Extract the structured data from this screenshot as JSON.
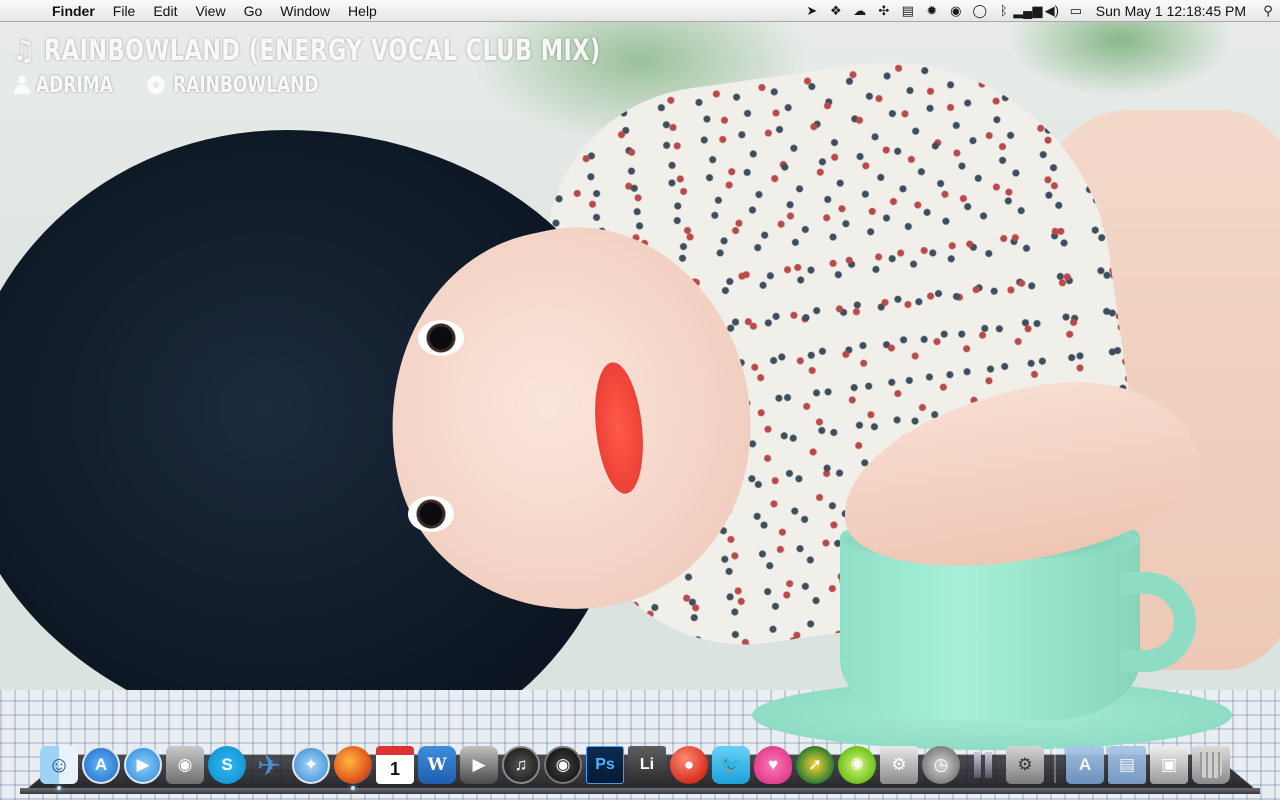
{
  "menubar": {
    "apple_glyph": "",
    "app_name": "Finder",
    "menus": [
      "File",
      "Edit",
      "View",
      "Go",
      "Window",
      "Help"
    ],
    "status_icons": [
      "cursor-icon",
      "dropbox-icon",
      "cloud-icon",
      "sync-icon",
      "notes-icon",
      "brightness-icon",
      "record-icon",
      "chat-icon",
      "bluetooth-icon",
      "signal-icon",
      "volume-icon",
      "battery-icon"
    ],
    "clock": "Sun May 1  12:18:45 PM",
    "spotlight_icon": "spotlight-icon"
  },
  "now_playing": {
    "title": "Rainbowland (Energy Vocal Club Mix)",
    "artist": "Adrima",
    "album": "Rainbowland"
  },
  "dock": {
    "apps": [
      {
        "name": "finder-icon"
      },
      {
        "name": "app-store-icon"
      },
      {
        "name": "ichat-icon"
      },
      {
        "name": "facetime-icon"
      },
      {
        "name": "skype-icon",
        "glyph": "S"
      },
      {
        "name": "mail-icon",
        "glyph": "✈"
      },
      {
        "name": "safari-icon",
        "glyph": "✦"
      },
      {
        "name": "firefox-icon"
      },
      {
        "name": "ical-icon",
        "glyph": "1"
      },
      {
        "name": "word-icon",
        "glyph": "W"
      },
      {
        "name": "dvd-player-icon",
        "glyph": "▶"
      },
      {
        "name": "itunes-icon",
        "glyph": "♫"
      },
      {
        "name": "aperture-icon",
        "glyph": "◉"
      },
      {
        "name": "photoshop-icon",
        "glyph": "Ps"
      },
      {
        "name": "li-app-icon",
        "glyph": "Li"
      },
      {
        "name": "pin-app-icon",
        "glyph": "●"
      },
      {
        "name": "twitter-icon",
        "glyph": "🐦"
      },
      {
        "name": "heart-app-icon",
        "glyph": "♥"
      },
      {
        "name": "jdownloader-icon",
        "glyph": "➚"
      },
      {
        "name": "limewire-icon",
        "glyph": "✺"
      },
      {
        "name": "utilities-icon",
        "glyph": "⚙"
      },
      {
        "name": "time-machine-icon",
        "glyph": "◷"
      },
      {
        "name": "pause-app-icon"
      },
      {
        "name": "system-preferences-icon",
        "glyph": "⚙"
      }
    ],
    "stacks": [
      {
        "name": "applications-folder-icon",
        "glyph": "A"
      },
      {
        "name": "documents-folder-icon",
        "glyph": "▤"
      },
      {
        "name": "photos-stack-icon",
        "glyph": "▣"
      },
      {
        "name": "trash-icon"
      }
    ]
  }
}
